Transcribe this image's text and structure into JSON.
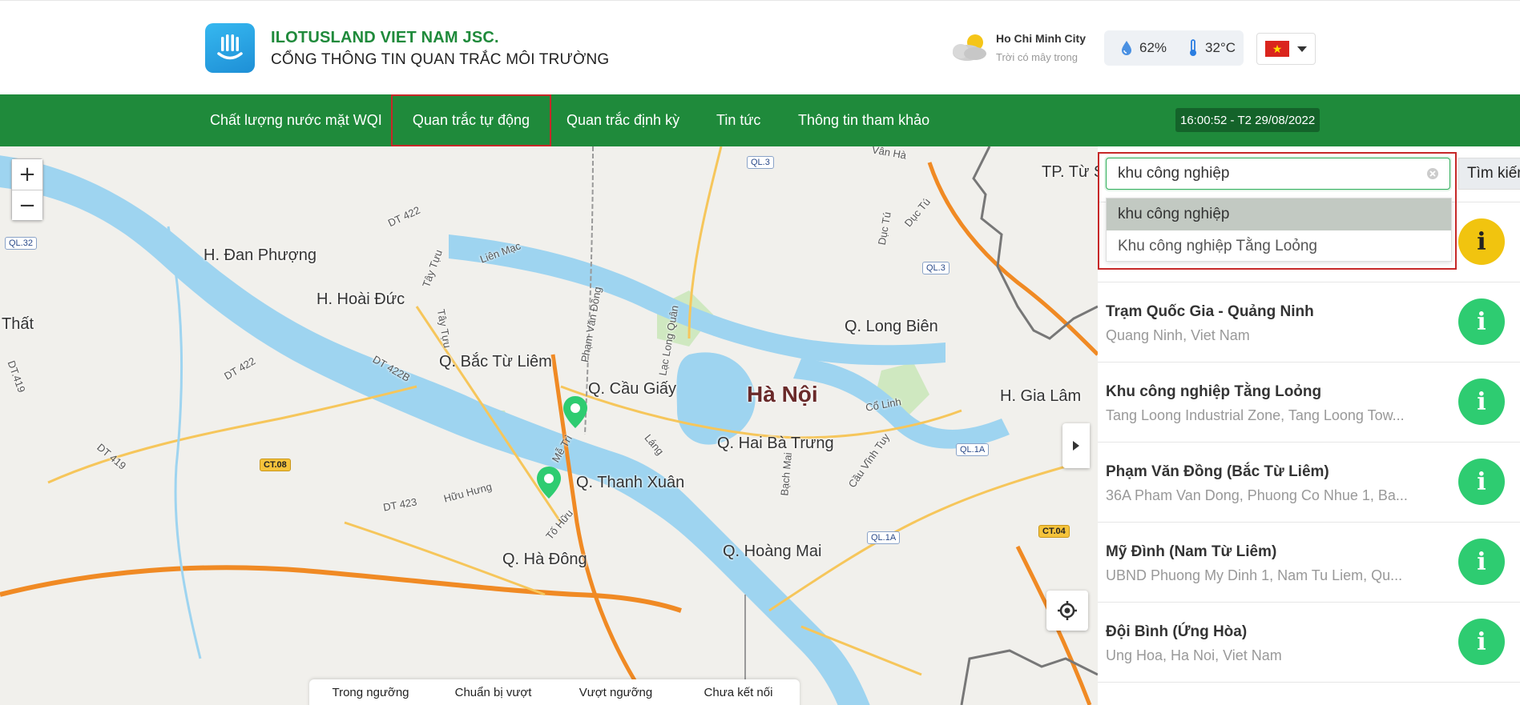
{
  "header": {
    "brand_name": "ILOTUSLAND VIET NAM JSC.",
    "portal_title": "CỔNG THÔNG TIN QUAN TRẮC MÔI TRƯỜNG",
    "logo_icon": "lotus-logo-icon"
  },
  "weather": {
    "city": "Ho Chi Minh City",
    "description": "Trời có mây trong",
    "humidity": "62%",
    "temperature": "32°C",
    "icon": "partly-cloudy-icon"
  },
  "language": {
    "flag": "vietnam-flag"
  },
  "nav": {
    "items": [
      {
        "label": "Chất lượng nước mặt WQI"
      },
      {
        "label": "Quan trắc tự động",
        "active": true
      },
      {
        "label": "Quan trắc định kỳ"
      },
      {
        "label": "Tin tức"
      },
      {
        "label": "Thông tin tham khảo"
      }
    ],
    "clock": "16:00:52 - T2 29/08/2022"
  },
  "map": {
    "zoom_in": "+",
    "zoom_out": "−",
    "labels": {
      "dan_phuong": "H. Đan Phượng",
      "hoai_duc": "H. Hoài Đức",
      "that": "Thất",
      "bac_tu_liem": "Q. Bắc Từ Liêm",
      "cau_giay": "Q. Cầu Giấy",
      "ha_noi": "Hà Nội",
      "hai_ba_trung": "Q. Hai Bà Trưng",
      "thanh_xuan": "Q. Thanh Xuân",
      "ha_dong": "Q. Hà Đông",
      "hoang_mai": "Q. Hoàng Mai",
      "long_bien": "Q. Long Biên",
      "gia_lam": "H. Gia Lâm",
      "tp_tu_son": "TP. Từ S",
      "dt422": "DT 422",
      "dt422_2": "DT 422",
      "dt422b": "DT 422B",
      "dt419": "DT 419",
      "dt419_2": "DT.419",
      "dt423": "DT 423",
      "lien_mac": "Liên Mạc",
      "tay_tuu": "Tây Tựu",
      "pham_van_dong": "Phạm Văn Đồng",
      "lac_long_quan": "Lạc Long Quân",
      "me_tri": "Mễ Trì",
      "lang": "Láng",
      "bach_mai": "Bạch Mai",
      "co_linh": "Cổ Linh",
      "cau_vinh_tuy": "Cầu Vĩnh Tuy",
      "huu_hung": "Hữu Hưng",
      "to_huu": "Tố Hữu",
      "duc_tu": "Dục Tú",
      "van_ha": "Vân Hà"
    },
    "badges": {
      "ql32": "QL.32",
      "ql3": "QL.3",
      "ql3_2": "QL.3",
      "ql1a": "QL.1A",
      "ql1a_2": "QL.1A",
      "ct08": "CT.08",
      "ct04": "CT.04"
    },
    "legend": [
      {
        "label": "Trong ngưỡng",
        "color": "#2ecc71"
      },
      {
        "label": "Chuẩn bị vượt",
        "color": "#f1c40f"
      },
      {
        "label": "Vượt ngưỡng",
        "color": "#e74c3c"
      },
      {
        "label": "Chưa kết nối",
        "color": "#9e9e9e"
      }
    ]
  },
  "search": {
    "value": "khu công nghiệp",
    "button_label": "Tìm kiếm",
    "suggestions": [
      {
        "label": "khu công nghiệp",
        "selected": true
      },
      {
        "label": "Khu công nghiệp Tằng Loỏng"
      }
    ]
  },
  "stations": [
    {
      "name": "Trạm Quốc Gia - Quảng Ninh",
      "address": "Quang Ninh, Viet Nam",
      "status_color": "#2ecc71"
    },
    {
      "name": "Khu công nghiệp Tằng Loỏng",
      "address": "Tang Loong Industrial Zone, Tang Loong Tow...",
      "status_color": "#2ecc71"
    },
    {
      "name": "Phạm Văn Đồng (Bắc Từ Liêm)",
      "address": "36A Pham Van Dong, Phuong Co Nhue 1, Ba...",
      "status_color": "#2ecc71"
    },
    {
      "name": "Mỹ Đình (Nam Từ Liêm)",
      "address": "UBND Phuong My Dinh 1, Nam Tu Liem, Qu...",
      "status_color": "#2ecc71"
    },
    {
      "name": "Đội Bình (Ứng Hòa)",
      "address": "Ung Hoa, Ha Noi, Viet Nam",
      "status_color": "#2ecc71"
    }
  ],
  "top_station_status_color": "#f1c40f",
  "colors": {
    "brand_green": "#1f8a3b",
    "highlight_red": "#c62828"
  }
}
